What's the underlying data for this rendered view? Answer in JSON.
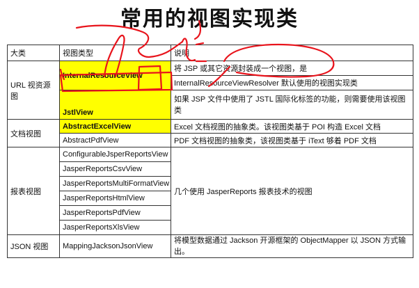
{
  "title": "常用的视图实现类",
  "table": {
    "headers": [
      "大类",
      "视图类型",
      "说明"
    ],
    "categories": {
      "url": "URL 视资源图",
      "document": "文档视图",
      "report": "报表视图",
      "json": "JSON 视图"
    },
    "views": {
      "internal_resource": "InternalResourceView",
      "jstl": "JstlView",
      "abstract_excel": "AbstractExcelView",
      "abstract_pdf": "AbstractPdfView",
      "configurable_jasper": "ConfigurableJsperReportsView",
      "jasper_csv": "JasperReportsCsvView",
      "jasper_multiformat": "JasperReportsMultiFormatView",
      "jasper_html": "JasperReportsHtmlView",
      "jasper_pdf": "JasperReportsPdfView",
      "jasper_xls": "JasperReportsXlsView",
      "mapping_jackson": "MappingJacksonJsonView"
    },
    "descriptions": {
      "internal_resource_1": "将 JSP 或其它资源封装成一个视图，是",
      "internal_resource_2": "InternalResourceViewResolver 默认使用的视图实现类",
      "jstl": "如果 JSP 文件中使用了 JSTL 国际化标签的功能，则需要使用该视图类",
      "abstract_excel": "Excel 文档视图的抽象类。该视图类基于 POI 构造 Excel 文档",
      "abstract_pdf": "PDF 文档视图的抽象类，该视图类基于 iText 够着 PDF 文档",
      "jasper": "几个使用 JasperReports 报表技术的视图",
      "mapping_jackson": "将模型数据通过 Jackson 开源框架的 ObjectMapper 以 JSON 方式输出。"
    },
    "highlight_color": "#ffff00",
    "annotation_color": "#e8141c"
  }
}
